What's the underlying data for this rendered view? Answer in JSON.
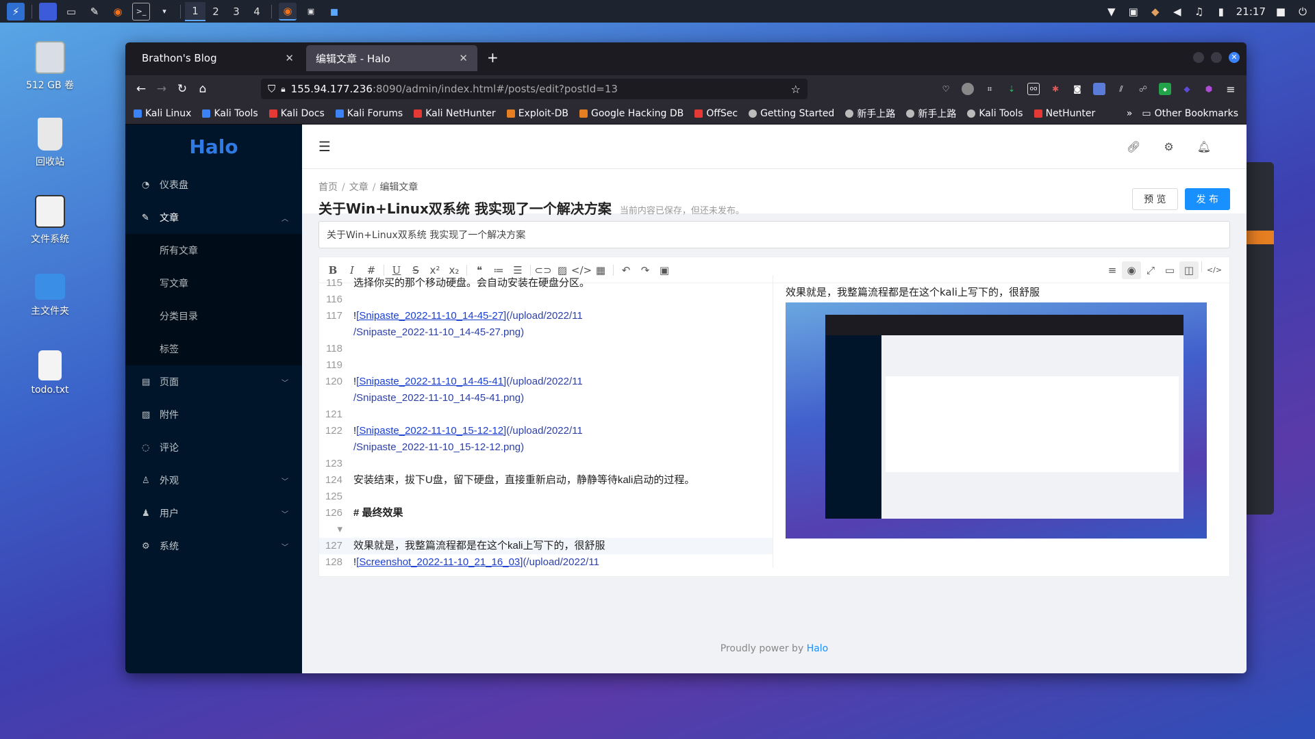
{
  "taskbar": {
    "workspaces": [
      "1",
      "2",
      "3",
      "4"
    ],
    "clock": "21:17"
  },
  "desktop": {
    "icons": [
      {
        "label": "512 GB 卷",
        "icon": "drive-icon"
      },
      {
        "label": "回收站",
        "icon": "trash-icon"
      },
      {
        "label": "文件系统",
        "icon": "filesystem-icon"
      },
      {
        "label": "主文件夹",
        "icon": "home-folder-icon"
      },
      {
        "label": "todo.txt",
        "icon": "text-file-icon"
      }
    ]
  },
  "browser": {
    "tabs": [
      {
        "title": "Brathon's Blog",
        "active": false
      },
      {
        "title": "编辑文章 - Halo",
        "active": true
      }
    ],
    "url": {
      "host": "155.94.177.236",
      "path": ":8090/admin/index.html#/posts/edit?postId=13"
    },
    "bookmarks": [
      {
        "label": "Kali Linux",
        "color": "#3b82f6"
      },
      {
        "label": "Kali Tools",
        "color": "#3b82f6"
      },
      {
        "label": "Kali Docs",
        "color": "#e53935"
      },
      {
        "label": "Kali Forums",
        "color": "#3b82f6"
      },
      {
        "label": "Kali NetHunter",
        "color": "#e53935"
      },
      {
        "label": "Exploit-DB",
        "color": "#e67e22"
      },
      {
        "label": "Google Hacking DB",
        "color": "#e67e22"
      },
      {
        "label": "OffSec",
        "color": "#e53935"
      },
      {
        "label": "Getting Started",
        "color": "#bbbbbb"
      },
      {
        "label": "新手上路",
        "color": "#bbbbbb"
      },
      {
        "label": "新手上路",
        "color": "#bbbbbb"
      },
      {
        "label": "Kali Tools",
        "color": "#bbbbbb"
      },
      {
        "label": "NetHunter",
        "color": "#e53935"
      }
    ],
    "other_bookmarks": "Other Bookmarks"
  },
  "halo": {
    "logo": "Halo",
    "menu": [
      {
        "label": "仪表盘",
        "icon": "dashboard-icon",
        "arrow": ""
      },
      {
        "label": "文章",
        "icon": "edit-icon",
        "arrow": "︿",
        "open": true
      },
      {
        "label": "页面",
        "icon": "page-icon",
        "arrow": "﹀"
      },
      {
        "label": "附件",
        "icon": "picture-icon",
        "arrow": ""
      },
      {
        "label": "评论",
        "icon": "comment-icon",
        "arrow": ""
      },
      {
        "label": "外观",
        "icon": "skin-icon",
        "arrow": "﹀"
      },
      {
        "label": "用户",
        "icon": "user-icon",
        "arrow": "﹀"
      },
      {
        "label": "系统",
        "icon": "setting-icon",
        "arrow": "﹀"
      }
    ],
    "submenu": [
      "所有文章",
      "写文章",
      "分类目录",
      "标签"
    ],
    "breadcrumb": [
      "首页",
      "文章",
      "编辑文章"
    ],
    "page_title": "关于Win+Linux双系统 我实现了一个解决方案",
    "save_status": "当前内容已保存，但还未发布。",
    "preview_btn": "预 览",
    "publish_btn": "发 布",
    "title_input": "关于Win+Linux双系统 我实现了一个解决方案",
    "editor_lines": [
      {
        "n": "115",
        "parts": [
          {
            "t": "选择你买的那个移动硬盘。会自动安装在硬盘分区。",
            "c": "plain"
          }
        ]
      },
      {
        "n": "116",
        "parts": []
      },
      {
        "n": "117",
        "parts": [
          {
            "t": "!",
            "c": "plain"
          },
          {
            "t": "[Snipaste_2022-11-10_14-45-27]",
            "c": "lnk"
          },
          {
            "t": "(/upload/2022/11",
            "c": "url"
          }
        ]
      },
      {
        "n": "",
        "parts": [
          {
            "t": "/Snipaste_2022-11-10_14-45-27.png)",
            "c": "url"
          }
        ]
      },
      {
        "n": "118",
        "parts": []
      },
      {
        "n": "119",
        "parts": []
      },
      {
        "n": "120",
        "parts": [
          {
            "t": "!",
            "c": "plain"
          },
          {
            "t": "[Snipaste_2022-11-10_14-45-41]",
            "c": "lnk"
          },
          {
            "t": "(/upload/2022/11",
            "c": "url"
          }
        ]
      },
      {
        "n": "",
        "parts": [
          {
            "t": "/Snipaste_2022-11-10_14-45-41.png)",
            "c": "url"
          }
        ]
      },
      {
        "n": "121",
        "parts": []
      },
      {
        "n": "122",
        "parts": [
          {
            "t": "!",
            "c": "plain"
          },
          {
            "t": "[Snipaste_2022-11-10_15-12-12]",
            "c": "lnk"
          },
          {
            "t": "(/upload/2022/11",
            "c": "url"
          }
        ]
      },
      {
        "n": "",
        "parts": [
          {
            "t": "/Snipaste_2022-11-10_15-12-12.png)",
            "c": "url"
          }
        ]
      },
      {
        "n": "123",
        "parts": []
      },
      {
        "n": "124",
        "parts": [
          {
            "t": "安装结束，拔下U盘，留下硬盘，直接重新启动，静静等待kali启动的过程。",
            "c": "plain"
          }
        ]
      },
      {
        "n": "125",
        "parts": []
      },
      {
        "n": "126 ▾",
        "parts": [
          {
            "t": "# 最终效果",
            "c": "h"
          }
        ]
      },
      {
        "n": "127",
        "parts": [
          {
            "t": "效果就是，我整篇流程都是在这个kali上写下的，很舒服",
            "c": "plain"
          }
        ],
        "cur": true
      },
      {
        "n": "128",
        "parts": [
          {
            "t": "!",
            "c": "plain"
          },
          {
            "t": "[Screenshot_2022-11-10_21_16_03]",
            "c": "lnk"
          },
          {
            "t": "(/upload/2022/11",
            "c": "url"
          }
        ]
      }
    ],
    "preview_text": "效果就是，我整篇流程都是在这个kali上写下的，很舒服",
    "footer_prefix": "Proudly power by ",
    "footer_link": "Halo"
  }
}
